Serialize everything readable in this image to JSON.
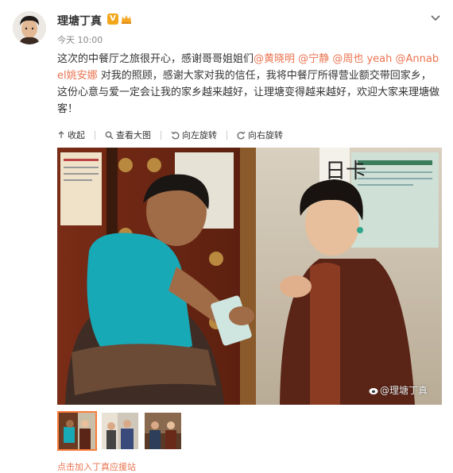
{
  "post": {
    "author": "理塘丁真",
    "verified_badge": "V",
    "timestamp": "今天 10:00",
    "text_segments": [
      {
        "t": "这次的中餐厅之旅很开心，感谢哥哥姐姐们",
        "m": false
      },
      {
        "t": "@黄晓明",
        "m": true
      },
      {
        "t": " ",
        "m": false
      },
      {
        "t": "@宁静",
        "m": true
      },
      {
        "t": " ",
        "m": false
      },
      {
        "t": "@周也",
        "m": true
      },
      {
        "t": " ",
        "m": false
      },
      {
        "t": "yeah",
        "m": true
      },
      {
        "t": " ",
        "m": false
      },
      {
        "t": "@Annabel姚安娜",
        "m": true
      },
      {
        "t": " 对我的照顾，感谢大家对我的信任，我将中餐厅所得营业额交带回家乡，这份心意与爱一定会让我的家乡越来越好，让理塘变得越来越好，欢迎大家来理塘做客！",
        "m": false
      }
    ],
    "mention_color": "#eb7350"
  },
  "toolbar": {
    "collapse": "收起",
    "view_large": "查看大图",
    "rotate_left": "向左旋转",
    "rotate_right": "向右旋转"
  },
  "photo": {
    "watermark": "@理塘丁真",
    "sign_text": "日卡"
  },
  "thumbnails": [
    {
      "name": "thumb-1",
      "active": true
    },
    {
      "name": "thumb-2",
      "active": false
    },
    {
      "name": "thumb-3",
      "active": false
    }
  ],
  "footer": {
    "link": "点击加入丁真应援站"
  },
  "icons": {
    "chevron": "chevron-down-icon",
    "collapse": "collapse-arrow-icon",
    "view_large": "magnify-icon",
    "rotate_left": "rotate-left-icon",
    "rotate_right": "rotate-right-icon",
    "watermark_logo": "weibo-logo-icon"
  }
}
